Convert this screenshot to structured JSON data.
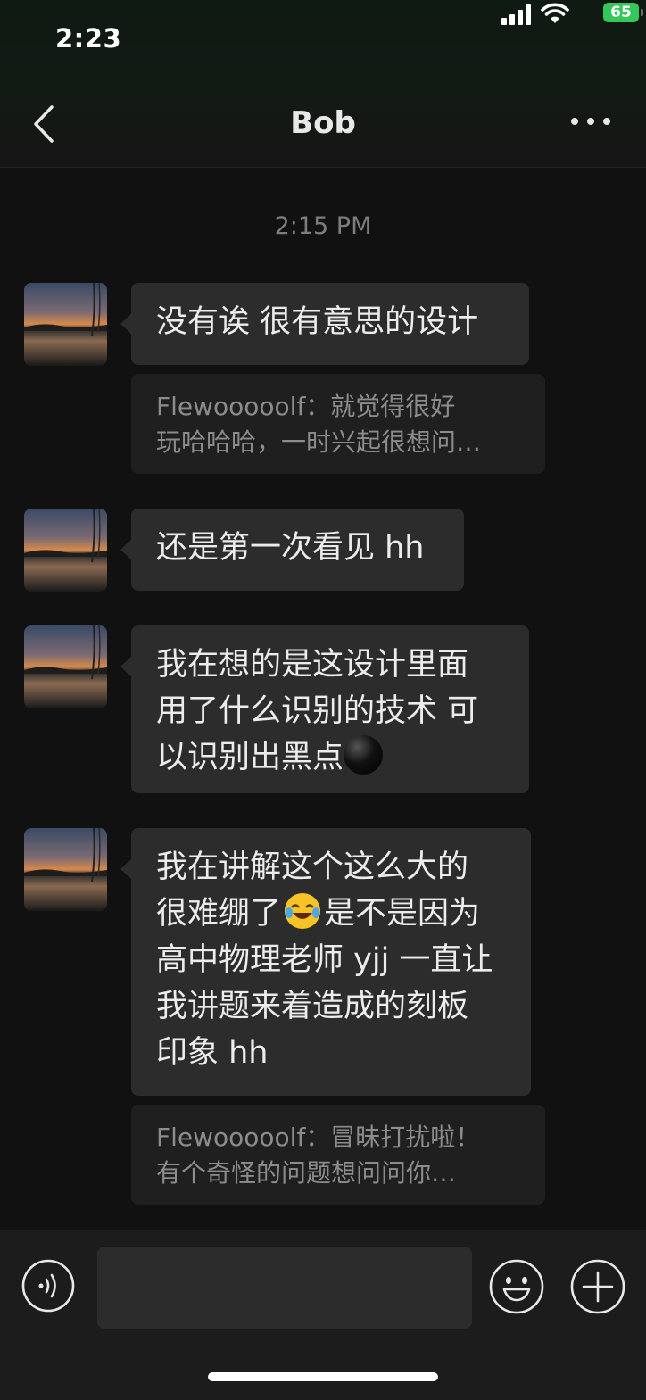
{
  "status_bar": {
    "time": "2:23",
    "battery": "65"
  },
  "nav": {
    "title": "Bob"
  },
  "chat": {
    "timestamp": "2:15 PM",
    "messages": [
      {
        "text": "没有诶 很有意思的设计",
        "quote": [
          "Flewooooolf：就觉得很好",
          "玩哈哈哈，一时兴起很想问…"
        ]
      },
      {
        "text": "还是第一次看见 hh"
      },
      {
        "lines": [
          "我在想的是这设计里面",
          "用了什么识别的技术 可",
          "以识别出黑点"
        ]
      },
      {
        "lines": [
          "我在讲解这个这么大的",
          "很难绷了",
          "是不是因为",
          "高中物理老师 yjj 一直让",
          "我讲题来着造成的刻板",
          "印象 hh"
        ],
        "quote": [
          "Flewooooolf：冒昧打扰啦！",
          "有个奇怪的问题想问问你…"
        ]
      }
    ]
  },
  "input": {
    "placeholder": ""
  },
  "icons": {
    "voice": "voice-icon",
    "emoji": "smiley-icon",
    "add": "plus-icon"
  }
}
